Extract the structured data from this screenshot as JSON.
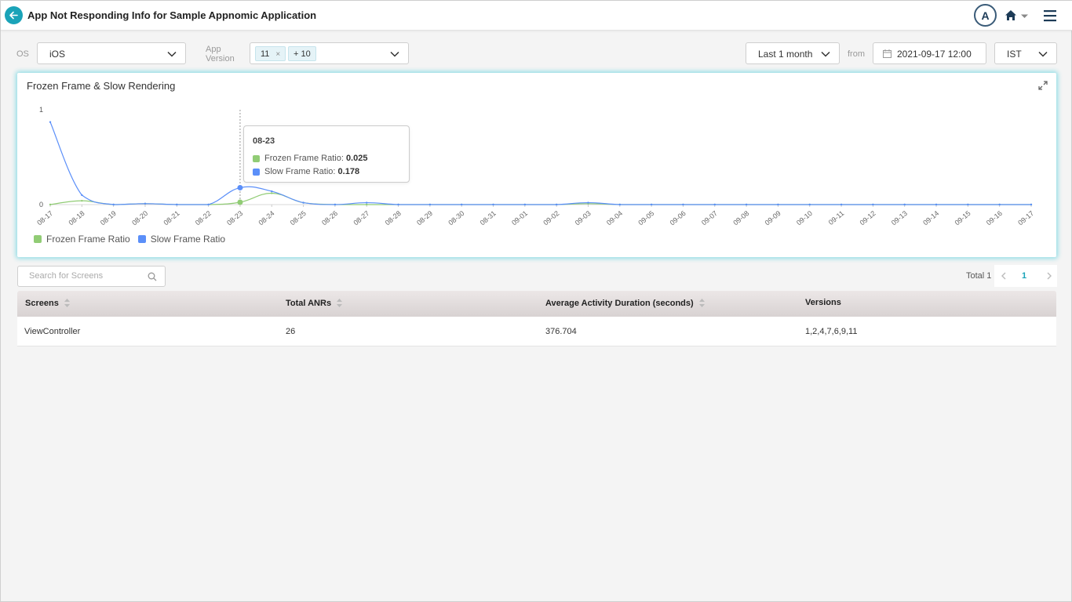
{
  "header": {
    "title": "App Not Responding Info for Sample Appnomic Application",
    "avatar_initial": "A"
  },
  "filters": {
    "os_label": "OS",
    "os_value": "iOS",
    "app_version_label": "App Version",
    "app_version_tags": [
      "11",
      "+ 10"
    ],
    "app_version_tag_remove": "×",
    "range_value": "Last 1 month",
    "from_label": "from",
    "from_date": "2021-09-17 12:00",
    "timezone": "IST"
  },
  "chart_card": {
    "title": "Frozen Frame & Slow Rendering",
    "tooltip": {
      "date": "08-23",
      "items": [
        {
          "label": "Frozen Frame Ratio",
          "value": "0.025"
        },
        {
          "label": "Slow Frame Ratio",
          "value": "0.178"
        }
      ]
    }
  },
  "chart_data": {
    "type": "line",
    "title": "Frozen Frame & Slow Rendering",
    "x": [
      "08-17",
      "08-18",
      "08-19",
      "08-20",
      "08-21",
      "08-22",
      "08-23",
      "08-24",
      "08-25",
      "08-26",
      "08-27",
      "08-28",
      "08-29",
      "08-30",
      "08-31",
      "09-01",
      "09-02",
      "09-03",
      "09-04",
      "09-05",
      "09-06",
      "09-07",
      "09-08",
      "09-09",
      "09-10",
      "09-11",
      "09-12",
      "09-13",
      "09-14",
      "09-15",
      "09-16",
      "09-17"
    ],
    "y_ticks": [
      "0",
      "1"
    ],
    "ylim": [
      0,
      1
    ],
    "legend_position": "bottom-left",
    "series": [
      {
        "name": "Frozen Frame Ratio",
        "color": "#91cc75",
        "values": [
          0,
          0.04,
          0,
          0.01,
          0,
          0,
          0.025,
          0.12,
          0.02,
          0,
          0,
          0,
          0,
          0,
          0,
          0,
          0,
          0.01,
          0,
          0,
          0,
          0,
          0,
          0,
          0,
          0,
          0,
          0,
          0,
          0,
          0,
          0
        ]
      },
      {
        "name": "Slow Frame Ratio",
        "color": "#5b8ff9",
        "values": [
          0.87,
          0.1,
          0,
          0.01,
          0,
          0,
          0.178,
          0.14,
          0.02,
          0,
          0.02,
          0,
          0,
          0,
          0,
          0,
          0,
          0.02,
          0,
          0,
          0,
          0,
          0,
          0,
          0,
          0,
          0,
          0,
          0,
          0,
          0,
          0
        ]
      }
    ]
  },
  "search": {
    "placeholder": "Search for Screens"
  },
  "pagination": {
    "total_label": "Total 1",
    "current_page": "1"
  },
  "table": {
    "columns": [
      "Screens",
      "Total ANRs",
      "Average Activity Duration (seconds)",
      "Versions"
    ],
    "rows": [
      [
        "ViewController",
        "26",
        "376.704",
        "1,2,4,7,6,9,11"
      ]
    ]
  }
}
